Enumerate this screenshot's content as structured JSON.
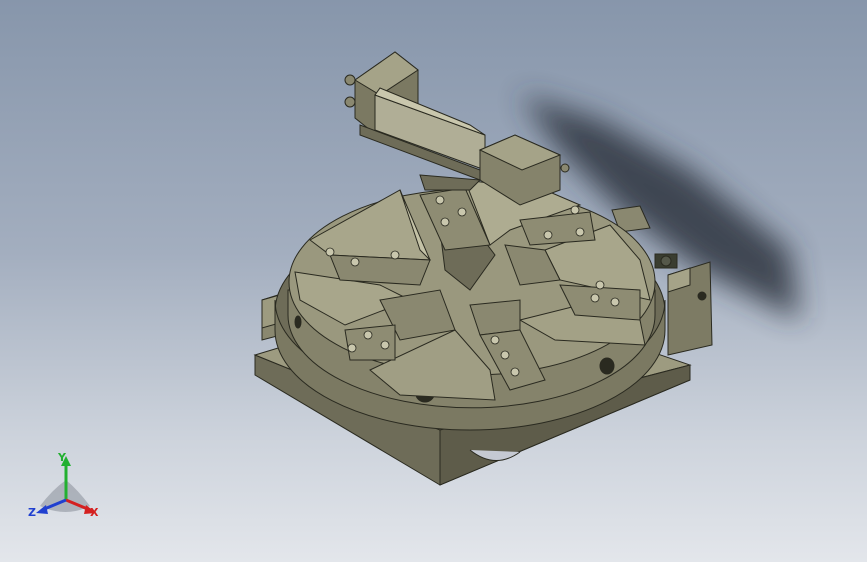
{
  "viewport": {
    "background_top": "#8796ab",
    "background_bottom": "#e3e6eb",
    "part_color": "#8f8d73",
    "shadow_color": "#2f3440"
  },
  "model": {
    "description_icon": "cad-model-icon",
    "jaw_count": 6
  },
  "triad": {
    "x_label": "X",
    "y_label": "Y",
    "z_label": "Z",
    "x_color": "#d42020",
    "y_color": "#22b030",
    "z_color": "#2040d0"
  }
}
